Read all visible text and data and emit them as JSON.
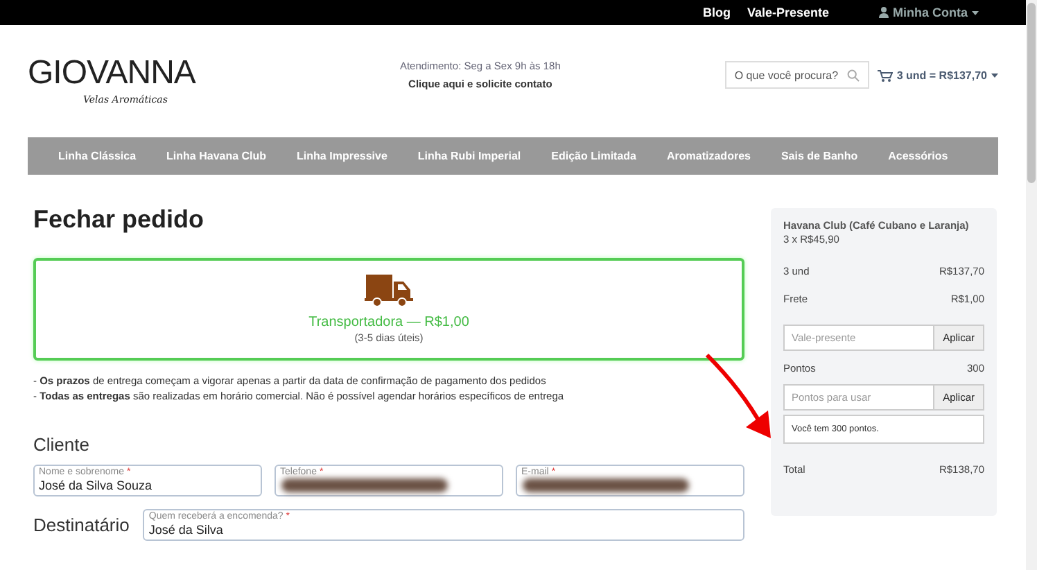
{
  "top_links": [
    {
      "label": "Blog"
    },
    {
      "label": "Vale-Presente"
    }
  ],
  "account": {
    "label": "Minha Conta"
  },
  "logo": {
    "name": "GIOVANNA",
    "tagline": "Velas Aromáticas"
  },
  "service": {
    "hours": "Atendimento: Seg a Sex 9h às 18h",
    "contact_link": "Clique aqui e solicite contato"
  },
  "search": {
    "placeholder": "O que você procura?"
  },
  "cart": {
    "label": "3 und = R$137,70"
  },
  "nav": [
    {
      "label": "Linha Clássica"
    },
    {
      "label": "Linha Havana Club"
    },
    {
      "label": "Linha Impressive"
    },
    {
      "label": "Linha Rubi Imperial"
    },
    {
      "label": "Edição Limitada"
    },
    {
      "label": "Aromatizadores"
    },
    {
      "label": "Sais de Banho"
    },
    {
      "label": "Acessórios"
    }
  ],
  "page_title": "Fechar pedido",
  "shipping_option": {
    "name": "Transportadora — R$1,00",
    "eta": "(3-5 dias úteis)",
    "selected": true
  },
  "notes": [
    "- **Os prazos** de entrega começam a vigorar apenas a partir da data de confirmação de pagamento dos pedidos",
    "- **Todas as entregas** são realizadas em horário comercial. Não é possível agendar horários específicos de entrega"
  ],
  "client": {
    "heading": "Cliente",
    "fields": [
      {
        "label": "Nome e sobrenome",
        "required_mark": "*",
        "value": "José da Silva Souza",
        "redacted": false
      },
      {
        "label": "Telefone",
        "required_mark": "*",
        "redacted": true
      },
      {
        "label": "E-mail",
        "required_mark": "*",
        "redacted": true
      }
    ]
  },
  "recipient": {
    "heading": "Destinatário",
    "field": {
      "label": "Quem receberá a encomenda?",
      "required_mark": "*",
      "value": "José da Silva",
      "redacted": false
    }
  },
  "summary": {
    "product": "Havana Club (Café Cubano e Laranja)",
    "unit_price": "3 x R$45,90",
    "lines": [
      {
        "label": "3 und",
        "value": "R$137,70"
      },
      {
        "label": "Frete",
        "value": "R$1,00"
      }
    ],
    "gift_card": {
      "placeholder": "Vale-presente",
      "button": "Aplicar"
    },
    "points": {
      "label": "Pontos",
      "value": "300"
    },
    "points_input": {
      "placeholder": "Pontos para usar",
      "button": "Aplicar"
    },
    "points_hint": "Você tem 300 pontos.",
    "total": {
      "label": "Total",
      "value": "R$138,70"
    }
  }
}
